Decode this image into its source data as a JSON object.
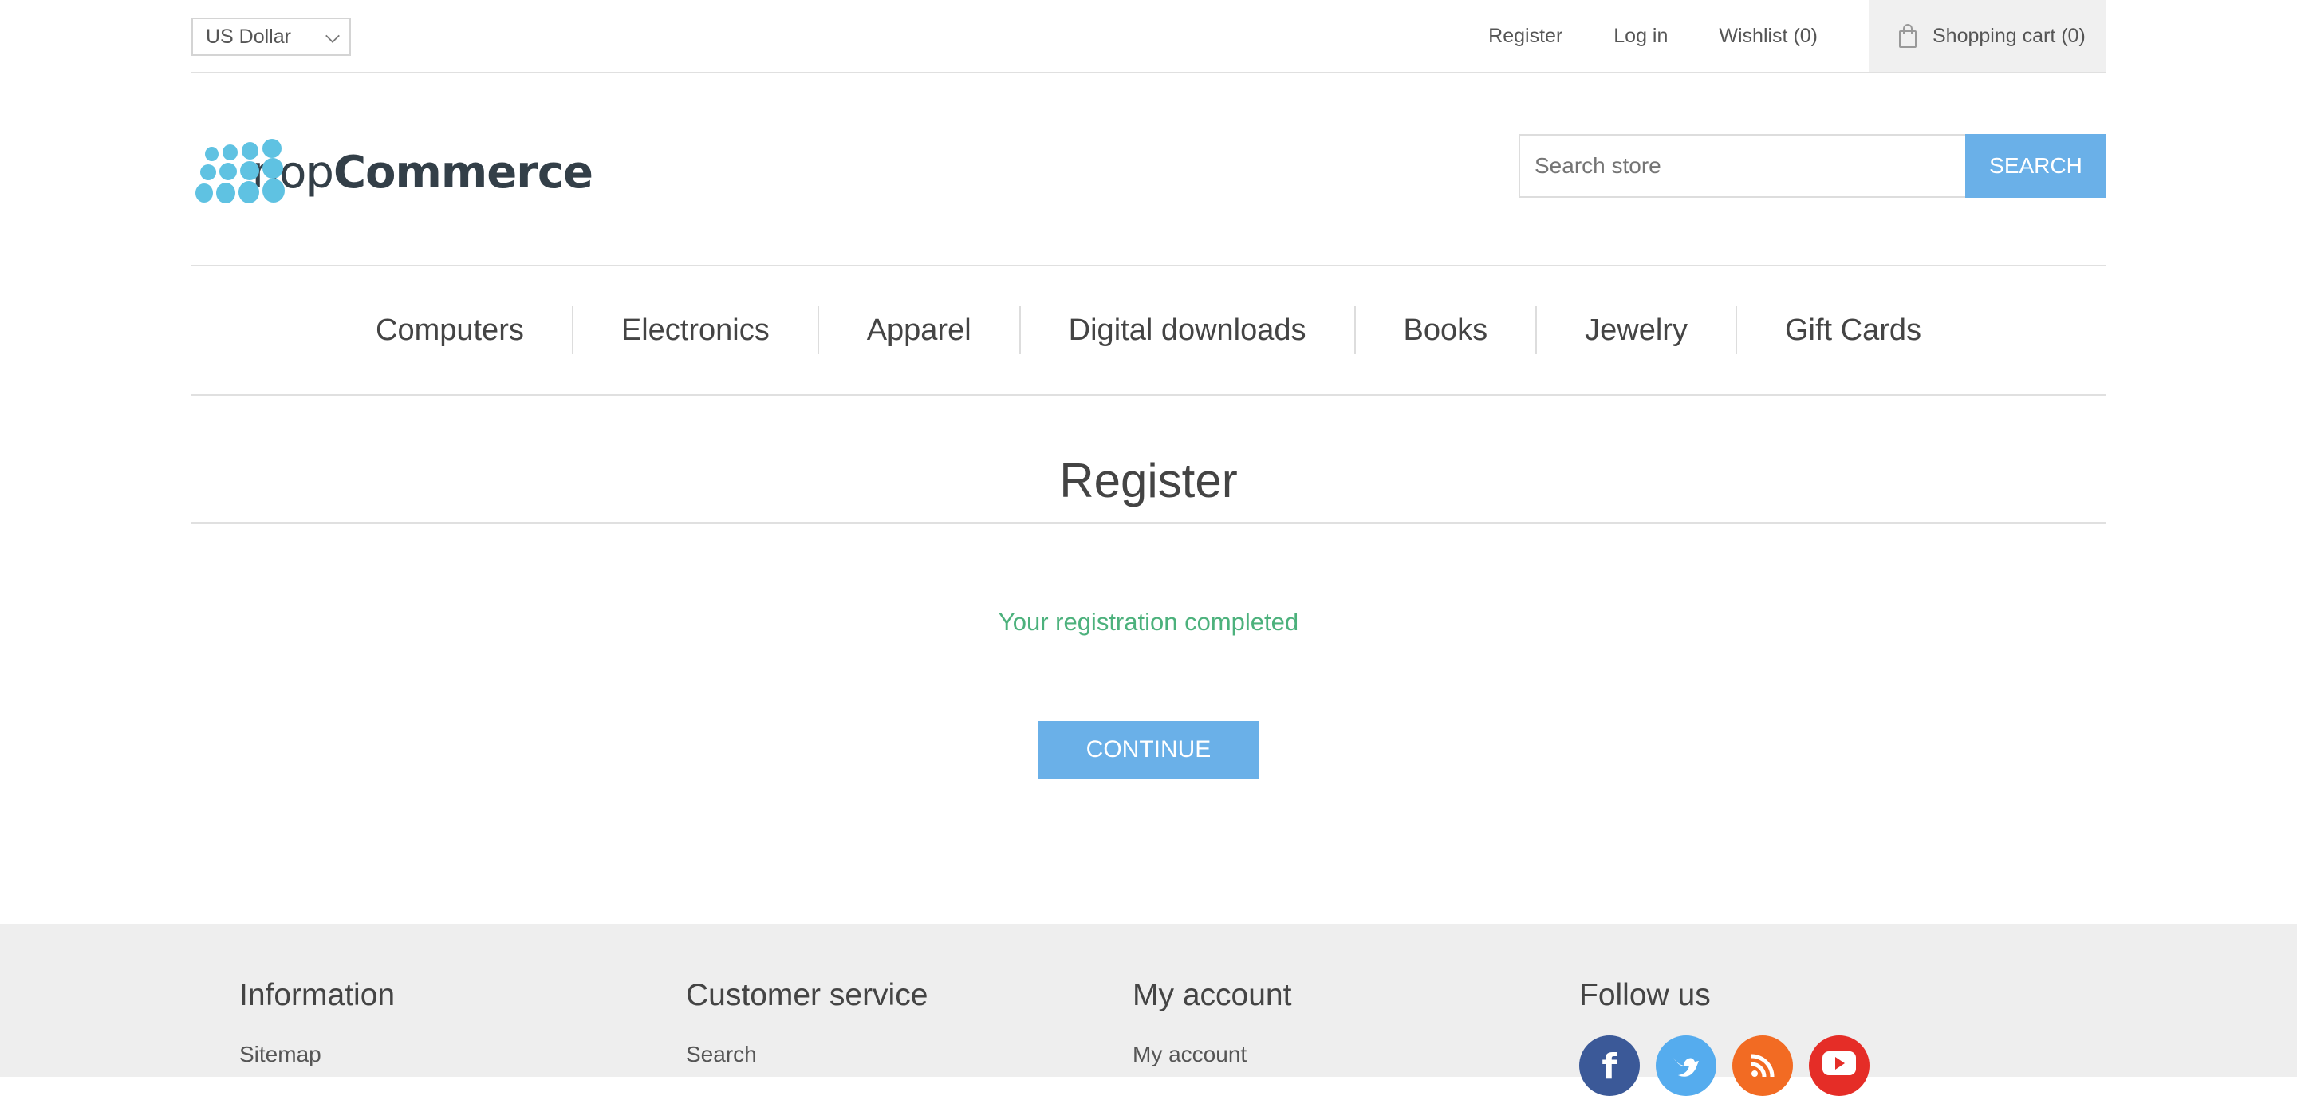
{
  "header": {
    "currency": "US Dollar",
    "links": {
      "register": "Register",
      "login": "Log in",
      "wishlist": "Wishlist (0)",
      "cart": "Shopping cart (0)"
    }
  },
  "logo": {
    "part1": "nop",
    "part2": "Commerce"
  },
  "search": {
    "placeholder": "Search store",
    "button": "SEARCH"
  },
  "nav": {
    "items": [
      "Computers",
      "Electronics",
      "Apparel",
      "Digital downloads",
      "Books",
      "Jewelry",
      "Gift Cards"
    ]
  },
  "page": {
    "title": "Register",
    "result": "Your registration completed",
    "continue": "CONTINUE"
  },
  "footer": {
    "information": {
      "title": "Information",
      "first_link": "Sitemap"
    },
    "customer_service": {
      "title": "Customer service",
      "first_link": "Search"
    },
    "my_account": {
      "title": "My account",
      "first_link": "My account"
    },
    "follow_us": {
      "title": "Follow us"
    }
  },
  "colors": {
    "accent": "#6ab0e8",
    "success": "#4cb17c",
    "footer_bg": "#eeeeee"
  }
}
